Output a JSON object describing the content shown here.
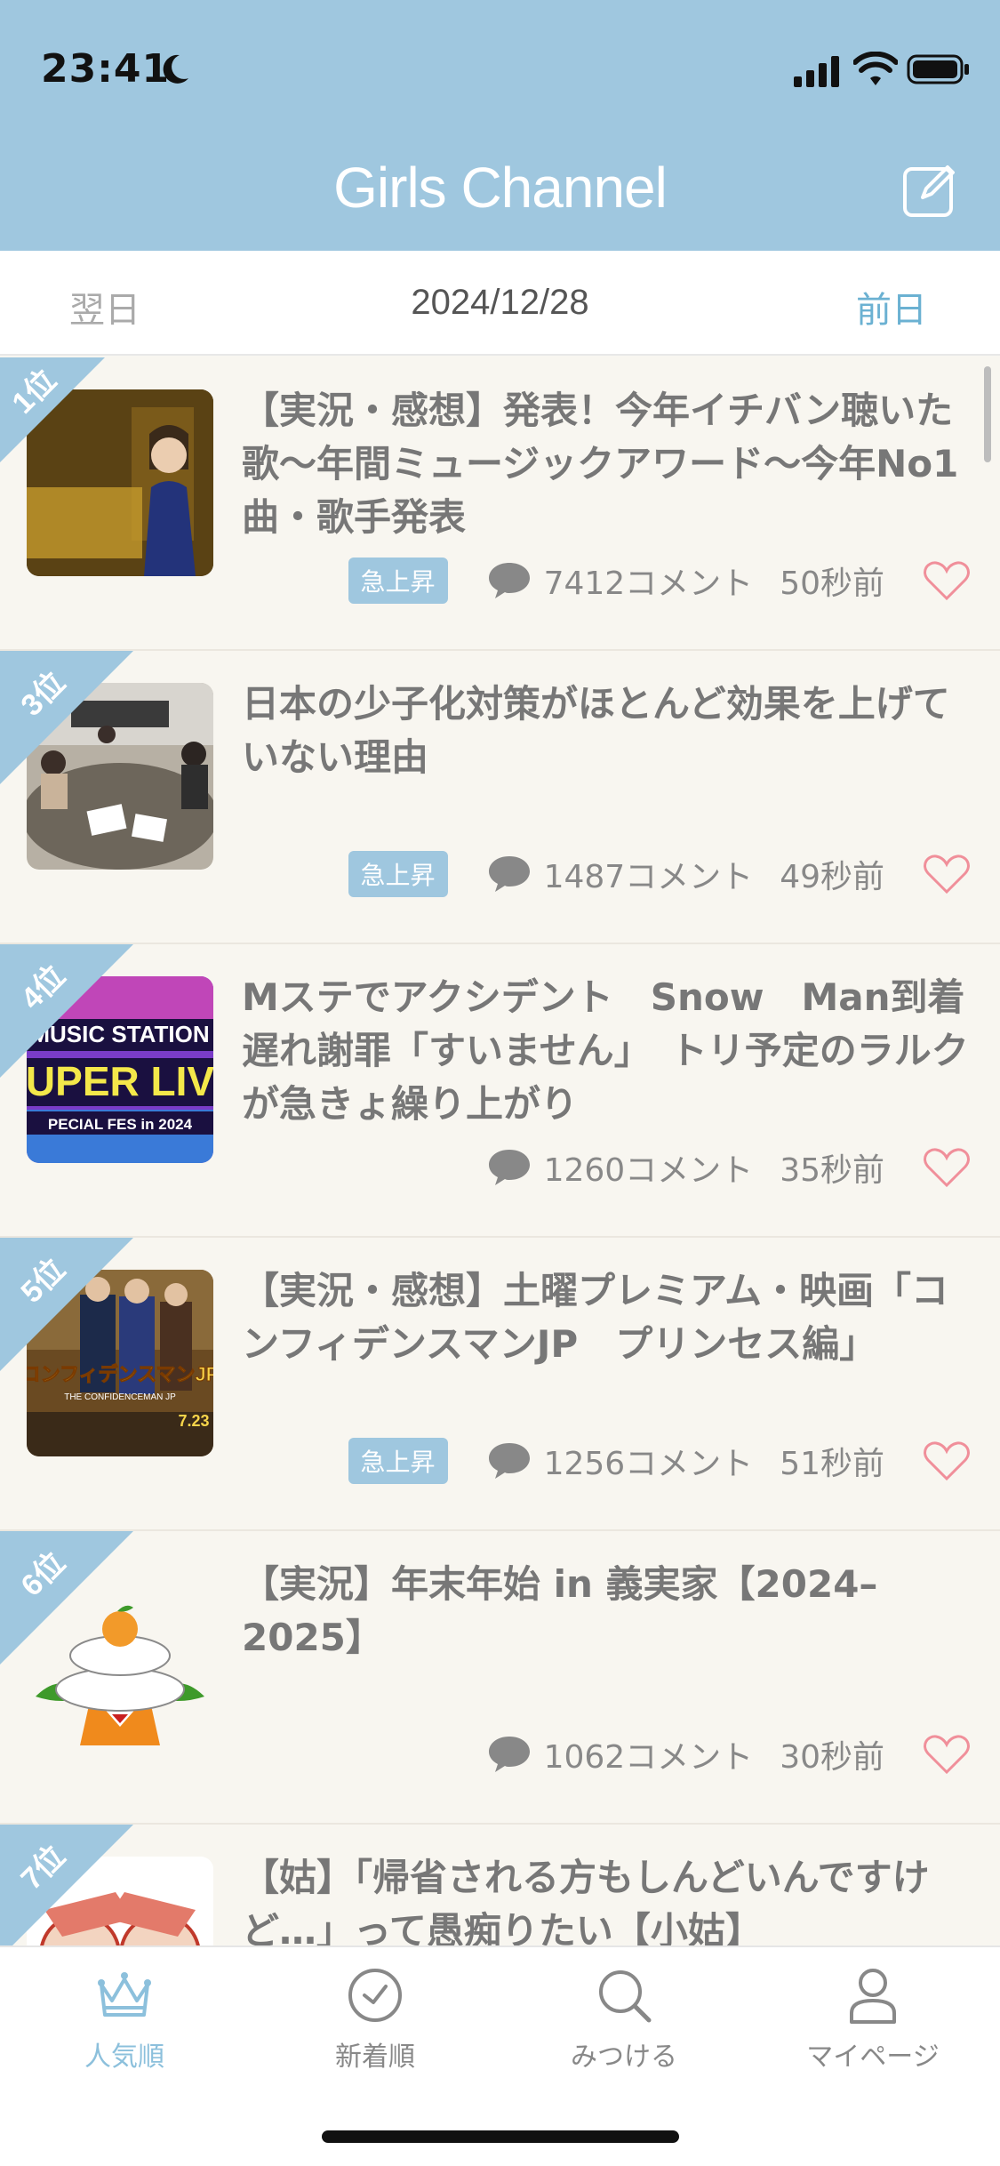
{
  "status": {
    "time": "23:41"
  },
  "header": {
    "title": "Girls Channel"
  },
  "datebar": {
    "next": "翌日",
    "date": "2024/12/28",
    "prev": "前日"
  },
  "topics": [
    {
      "rank": "1位",
      "title": "【実況・感想】発表！今年イチバン聴いた歌〜年間ミュージックアワード〜今年No1曲・歌手発表",
      "badge": "急上昇",
      "comments": "7412コメント",
      "ago": "50秒前"
    },
    {
      "rank": "3位",
      "title": "日本の少子化対策がほとんど効果を上げていない理由",
      "badge": "急上昇",
      "comments": "1487コメント",
      "ago": "49秒前"
    },
    {
      "rank": "4位",
      "title": "Mステでアクシデント　Snow　Man到着遅れ謝罪「すいません」　トリ予定のラルクが急きょ繰り上がり",
      "badge": "",
      "comments": "1260コメント",
      "ago": "35秒前",
      "thumb_text": [
        "MUSIC STATION",
        "UPER LIV",
        "PECIAL FES in 2024"
      ]
    },
    {
      "rank": "5位",
      "title": "【実況・感想】土曜プレミアム・映画「コンフィデンスマンJP　プリンセス編」",
      "badge": "急上昇",
      "comments": "1256コメント",
      "ago": "51秒前",
      "thumb_text": [
        "コンフィデンスマンJP",
        "THE CONFIDENCEMAN JP",
        "7.23"
      ]
    },
    {
      "rank": "6位",
      "title": "【実況】年末年始 in 義実家【2024–2025】",
      "badge": "",
      "comments": "1062コメント",
      "ago": "30秒前"
    },
    {
      "rank": "7位",
      "title": "【姑】「帰省される方もしんどいんですけど…」って愚痴りたい【小姑】",
      "badge": "",
      "comments": "",
      "ago": ""
    }
  ],
  "tabs": [
    {
      "label": "人気順",
      "icon": "crown-icon",
      "active": true
    },
    {
      "label": "新着順",
      "icon": "clock-icon",
      "active": false
    },
    {
      "label": "みつける",
      "icon": "search-icon",
      "active": false
    },
    {
      "label": "マイページ",
      "icon": "person-icon",
      "active": false
    }
  ],
  "colors": {
    "header": "#9fc7df",
    "accent": "#6bb1d2",
    "heart": "#f08f9a",
    "background": "#f8f6f0"
  }
}
